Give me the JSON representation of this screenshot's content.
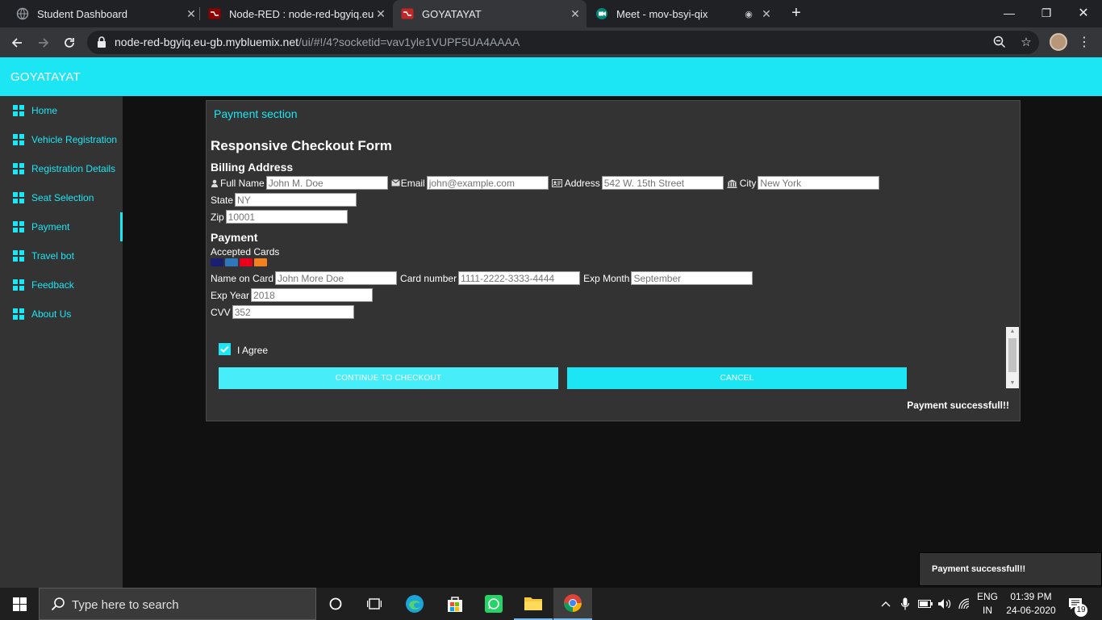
{
  "browser": {
    "tabs": [
      {
        "title": "Student Dashboard",
        "icon": "globe-icon"
      },
      {
        "title": "Node-RED : node-red-bgyiq.eu-g",
        "icon": "node-red-icon"
      },
      {
        "title": "GOYATAYAT",
        "icon": "node-red-icon"
      },
      {
        "title": "Meet - mov-bsyi-qix",
        "icon": "meet-icon"
      }
    ],
    "active_tab": 2,
    "url_host": "node-red-bgyiq.eu-gb.mybluemix.net",
    "url_path": "/ui/#!/4?socketid=vav1yle1VUPF5UA4AAAA"
  },
  "app": {
    "title": "GOYATAYAT",
    "accent": "#1de6f4"
  },
  "sidebar": {
    "items": [
      {
        "label": "Home"
      },
      {
        "label": "Vehicle Registration"
      },
      {
        "label": "Registration Details"
      },
      {
        "label": "Seat Selection"
      },
      {
        "label": "Payment"
      },
      {
        "label": "Travel bot"
      },
      {
        "label": "Feedback"
      },
      {
        "label": "About Us"
      }
    ],
    "active_index": 4
  },
  "card": {
    "header": "Payment section",
    "form_title": "Responsive Checkout Form",
    "billing": {
      "heading": "Billing Address",
      "full_name_label": "Full Name",
      "full_name_placeholder": "John M. Doe",
      "email_label": "Email",
      "email_placeholder": "john@example.com",
      "address_label": "Address",
      "address_placeholder": "542 W. 15th Street",
      "city_label": "City",
      "city_placeholder": "New York",
      "state_label": "State",
      "state_placeholder": "NY",
      "zip_label": "Zip",
      "zip_placeholder": "10001"
    },
    "payment": {
      "heading": "Payment",
      "accepted_cards_label": "Accepted Cards",
      "card_logos": [
        {
          "name": "visa",
          "color": "#1a1f71"
        },
        {
          "name": "amex",
          "color": "#2e77bb"
        },
        {
          "name": "mastercard",
          "color": "#eb001b"
        },
        {
          "name": "discover",
          "color": "#f48120"
        }
      ],
      "name_on_card_label": "Name on Card",
      "name_on_card_placeholder": "John More Doe",
      "card_number_label": "Card number",
      "card_number_placeholder": "1111-2222-3333-4444",
      "exp_month_label": "Exp Month",
      "exp_month_placeholder": "September",
      "exp_year_label": "Exp Year",
      "exp_year_placeholder": "2018",
      "cvv_label": "CVV",
      "cvv_placeholder": "352"
    },
    "agree_label": "I Agree",
    "agree_checked": true,
    "checkout_button": "CONTINUE TO CHECKOUT",
    "cancel_button": "CANCEL",
    "status_text": "Payment successfull!!"
  },
  "toast": {
    "text": "Payment successfull!!"
  },
  "taskbar": {
    "search_placeholder": "Type here to search",
    "lang_line1": "ENG",
    "lang_line2": "IN",
    "time": "01:39 PM",
    "date": "24-06-2020",
    "notification_count": "19"
  }
}
